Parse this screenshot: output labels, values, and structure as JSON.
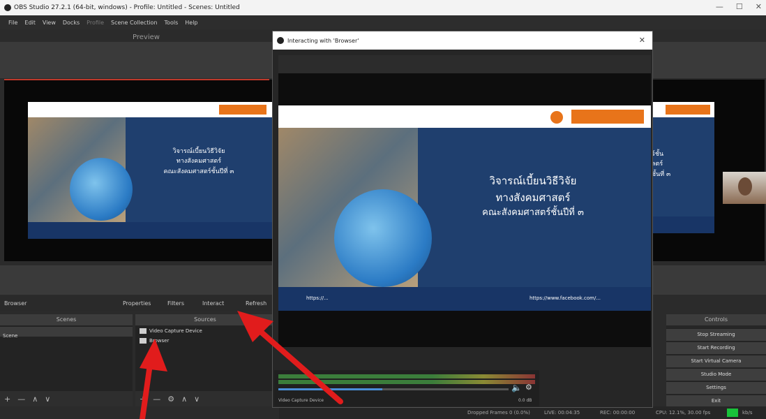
{
  "app": {
    "title": "OBS Studio 27.2.1 (64-bit, windows) - Profile: Untitled - Scenes: Untitled",
    "window_controls": [
      "—",
      "☐",
      "✕"
    ]
  },
  "menu": [
    "File",
    "Edit",
    "View",
    "Docks",
    "Profile",
    "Scene Collection",
    "Tools",
    "Help"
  ],
  "preview_label": "Preview",
  "slide": {
    "line1": "วิจารณ์เบี้ยนวิธีวิจัย",
    "line2": "ทางสังคมศาสตร์",
    "line3": "คณะสังคมศาสตร์ชั้นปีที่ ๓",
    "website": "https://...",
    "facebook": "https://www.facebook.com/..."
  },
  "source_toolbar": {
    "source_name": "Browser",
    "properties": "Properties",
    "filters": "Filters",
    "interact": "Interact",
    "refresh": "Refresh"
  },
  "scenes": {
    "header": "Scenes",
    "items": [
      "Scene"
    ]
  },
  "sources": {
    "header": "Sources",
    "items": [
      "Video Capture Device",
      "Browser"
    ]
  },
  "controls": {
    "header": "Controls",
    "buttons": [
      "Stop Streaming",
      "Start Recording",
      "Start Virtual Camera",
      "Studio Mode",
      "Settings",
      "Exit"
    ]
  },
  "status": {
    "dropped": "Dropped Frames 0 (0.0%)",
    "live": "LIVE: 00:04:35",
    "rec": "REC: 00:00:00",
    "cpu": "CPU: 12.1%, 30.00 fps",
    "bitrate": "kb/s"
  },
  "dialog": {
    "title": "Interacting with 'Browser'",
    "close": "✕"
  },
  "mixer": {
    "track_label": "Video Capture Device",
    "db": "0.0 dB",
    "volume_level": 0.45
  },
  "colors": {
    "accent_red": "#e11c1c",
    "slide_blue": "#1f3f6e",
    "orange": "#e8741a",
    "live_green": "#19c23a"
  }
}
